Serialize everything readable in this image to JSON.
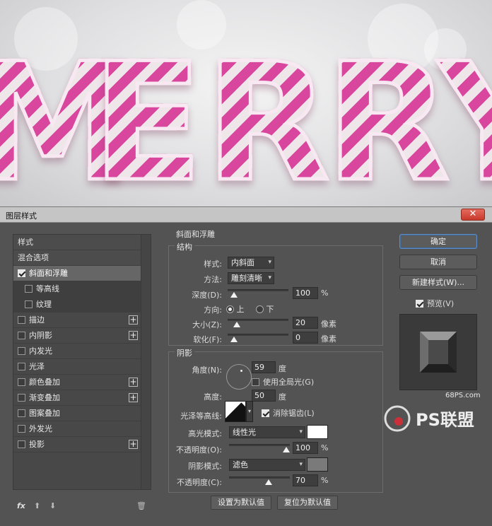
{
  "artwork": {
    "letters": [
      "M",
      "E",
      "R",
      "R",
      "Y"
    ]
  },
  "dialog": {
    "title": "图层样式",
    "close_glyph": "✕",
    "left_panel": {
      "header_styles": "样式",
      "header_blend": "混合选项",
      "items": [
        {
          "label": "斜面和浮雕",
          "checked": true,
          "plus": false,
          "selected": true
        },
        {
          "label": "等高线",
          "checked": false,
          "plus": false,
          "sub": true
        },
        {
          "label": "纹理",
          "checked": false,
          "plus": false,
          "sub": true
        },
        {
          "label": "描边",
          "checked": false,
          "plus": true
        },
        {
          "label": "内阴影",
          "checked": false,
          "plus": true
        },
        {
          "label": "内发光",
          "checked": false,
          "plus": false
        },
        {
          "label": "光泽",
          "checked": false,
          "plus": false
        },
        {
          "label": "颜色叠加",
          "checked": false,
          "plus": true
        },
        {
          "label": "渐变叠加",
          "checked": false,
          "plus": true
        },
        {
          "label": "图案叠加",
          "checked": false,
          "plus": false
        },
        {
          "label": "外发光",
          "checked": false,
          "plus": false
        },
        {
          "label": "投影",
          "checked": false,
          "plus": true
        }
      ],
      "fx_label": "fx",
      "up_glyph": "⬆",
      "down_glyph": "⬇",
      "trash_glyph": "🗑"
    },
    "bevel": {
      "title": "斜面和浮雕",
      "structure_title": "结构",
      "style_label": "样式:",
      "style_value": "内斜面",
      "technique_label": "方法:",
      "technique_value": "雕刻清晰",
      "depth_label": "深度(D):",
      "depth_value": "100",
      "depth_unit": "%",
      "depth_level": 0.0,
      "direction_label": "方向:",
      "direction_up": "上",
      "direction_down": "下",
      "size_label": "大小(Z):",
      "size_value": "20",
      "size_unit": "像素",
      "soften_label": "软化(F):",
      "soften_value": "0",
      "soften_unit": "像素"
    },
    "shading": {
      "title": "阴影",
      "angle_label": "角度(N):",
      "angle_value": "59",
      "angle_unit": "度",
      "global_light_label": "使用全局光(G)",
      "altitude_label": "高度:",
      "altitude_value": "50",
      "altitude_unit": "度",
      "gloss_contour_label": "光泽等高线:",
      "antialias_label": "消除锯齿(L)",
      "highlight_mode_label": "高光模式:",
      "highlight_mode_value": "线性光",
      "highlight_color": "#ffffff",
      "highlight_opacity_label": "不透明度(O):",
      "highlight_opacity_value": "100",
      "highlight_opacity_unit": "%",
      "shadow_mode_label": "阴影模式:",
      "shadow_mode_value": "滤色",
      "shadow_color": "#7a7a7a",
      "shadow_opacity_label": "不透明度(C):",
      "shadow_opacity_value": "70",
      "shadow_opacity_unit": "%"
    },
    "buttons": {
      "make_default": "设置为默认值",
      "reset_default": "复位为默认值",
      "ok": "确定",
      "cancel": "取消",
      "new_style": "新建样式(W)...",
      "preview_label": "预览(V)"
    },
    "watermark": {
      "url": "68PS.com",
      "brand": "PS联盟"
    }
  }
}
